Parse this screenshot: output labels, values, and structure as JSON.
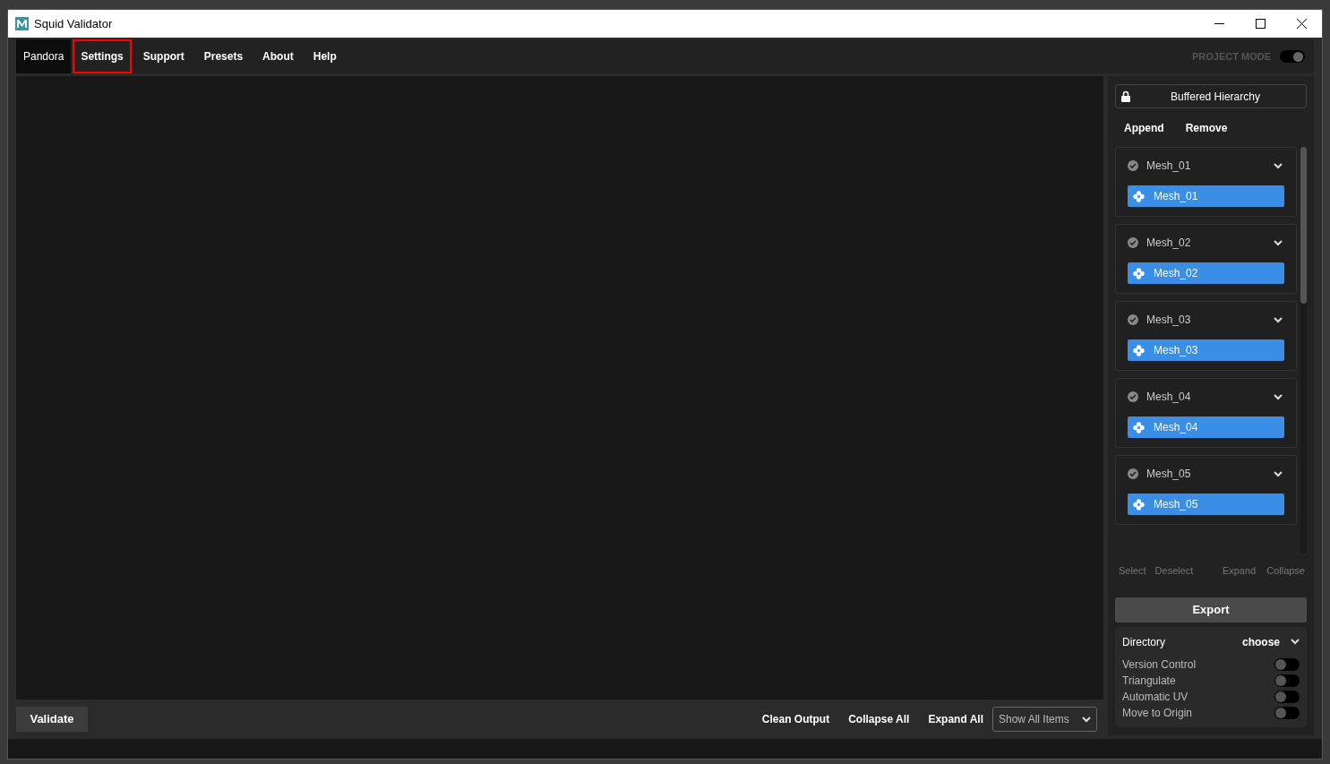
{
  "window": {
    "title": "Squid Validator"
  },
  "tabs": [
    {
      "label": "Pandora",
      "selected": true,
      "outlined": false
    },
    {
      "label": "Settings",
      "selected": false,
      "outlined": true
    },
    {
      "label": "Support",
      "selected": false,
      "outlined": false
    },
    {
      "label": "Presets",
      "selected": false,
      "outlined": false
    },
    {
      "label": "About",
      "selected": false,
      "outlined": false
    },
    {
      "label": "Help",
      "selected": false,
      "outlined": false
    }
  ],
  "project_mode": {
    "label": "PROJECT MODE",
    "on": true
  },
  "hierarchy": {
    "label": "Buffered Hierarchy"
  },
  "hierarchy_actions": [
    "Append",
    "Remove"
  ],
  "groups": [
    {
      "name": "Mesh_01",
      "expanded": true,
      "children": [
        {
          "name": "Mesh_01",
          "selected": true
        }
      ]
    },
    {
      "name": "Mesh_02",
      "expanded": true,
      "children": [
        {
          "name": "Mesh_02",
          "selected": true
        }
      ]
    },
    {
      "name": "Mesh_03",
      "expanded": true,
      "children": [
        {
          "name": "Mesh_03",
          "selected": true
        }
      ]
    },
    {
      "name": "Mesh_04",
      "expanded": true,
      "children": [
        {
          "name": "Mesh_04",
          "selected": true
        }
      ]
    },
    {
      "name": "Mesh_05",
      "expanded": true,
      "children": [
        {
          "name": "Mesh_05",
          "selected": true
        }
      ]
    }
  ],
  "list_actions_left": [
    "Select",
    "Deselect"
  ],
  "list_actions_right": [
    "Expand",
    "Collapse"
  ],
  "export": {
    "label": "Export"
  },
  "directory": {
    "label": "Directory",
    "value": "choose"
  },
  "options": [
    {
      "label": "Version Control",
      "on": false
    },
    {
      "label": "Triangulate",
      "on": false
    },
    {
      "label": "Automatic UV",
      "on": false
    },
    {
      "label": "Move to Origin",
      "on": false
    }
  ],
  "validate": {
    "label": "Validate"
  },
  "output_actions": [
    "Clean Output",
    "Collapse All",
    "Expand All"
  ],
  "filter": {
    "value": "Show All Items"
  }
}
